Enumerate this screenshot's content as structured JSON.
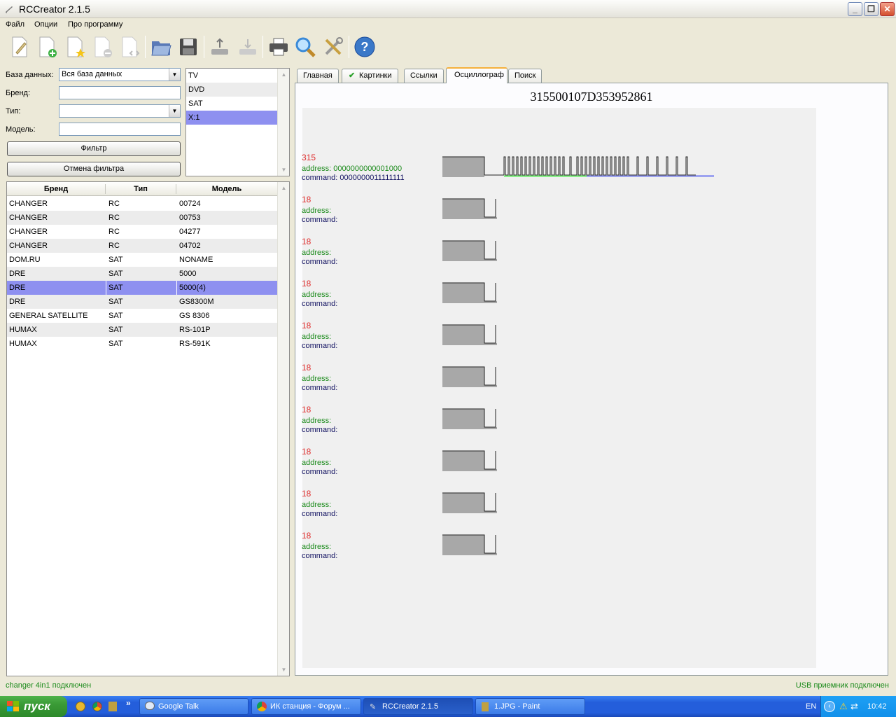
{
  "window": {
    "title": "RCCreator 2.1.5"
  },
  "menu": [
    "Файл",
    "Опции",
    "Про программу"
  ],
  "filter": {
    "db_label": "База данных:",
    "db_value": "Вся база данных",
    "brand_label": "Бренд:",
    "type_label": "Тип:",
    "model_label": "Модель:",
    "filter_button": "Фильтр",
    "cancel_button": "Отмена фильтра"
  },
  "type_list": [
    "TV",
    "DVD",
    "SAT",
    "X:1"
  ],
  "table": {
    "headers": [
      "Бренд",
      "Тип",
      "Модель"
    ],
    "rows": [
      [
        "CHANGER",
        "RC",
        "00724"
      ],
      [
        "CHANGER",
        "RC",
        "00753"
      ],
      [
        "CHANGER",
        "RC",
        "04277"
      ],
      [
        "CHANGER",
        "RC",
        "04702"
      ],
      [
        "DOM.RU",
        "SAT",
        "NONAME"
      ],
      [
        "DRE",
        "SAT",
        "5000"
      ],
      [
        "DRE",
        "SAT",
        "5000(4)"
      ],
      [
        "DRE",
        "SAT",
        "GS8300M"
      ],
      [
        "GENERAL SATELLITE",
        "SAT",
        "GS 8306"
      ],
      [
        "HUMAX",
        "SAT",
        "RS-101P"
      ],
      [
        "HUMAX",
        "SAT",
        "RS-591K"
      ]
    ],
    "selected_index": 6
  },
  "tabs": [
    "Главная",
    "Картинки",
    "Ссылки",
    "Осциллограф",
    "Поиск"
  ],
  "active_tab": "Осциллограф",
  "oscillograph": {
    "code": "315500107D353952861",
    "signals": [
      {
        "num": "315",
        "address": "address: 0000000000001000",
        "command": "command: 0000000011111111"
      },
      {
        "num": "18",
        "address": "address:",
        "command": "command:"
      },
      {
        "num": "18",
        "address": "address:",
        "command": "command:"
      },
      {
        "num": "18",
        "address": "address:",
        "command": "command:"
      },
      {
        "num": "18",
        "address": "address:",
        "command": "command:"
      },
      {
        "num": "18",
        "address": "address:",
        "command": "command:"
      },
      {
        "num": "18",
        "address": "address:",
        "command": "command:"
      },
      {
        "num": "18",
        "address": "address:",
        "command": "command:"
      },
      {
        "num": "18",
        "address": "address:",
        "command": "command:"
      },
      {
        "num": "18",
        "address": "address:",
        "command": "command:"
      }
    ]
  },
  "status": {
    "left": "changer 4in1 подключен",
    "right": "USB приемник подключен"
  },
  "taskbar": {
    "start": "пуск",
    "tasks": [
      "Google Talk",
      "ИК станция - Форум ...",
      "RCCreator 2.1.5",
      "1.JPG - Paint"
    ],
    "lang": "EN",
    "clock": "10:42"
  },
  "colors": {
    "selection": "#8e90f0",
    "address_green": "#1a8a1a",
    "number_red": "#e03030",
    "active_tab_accent": "#f5b03c"
  }
}
